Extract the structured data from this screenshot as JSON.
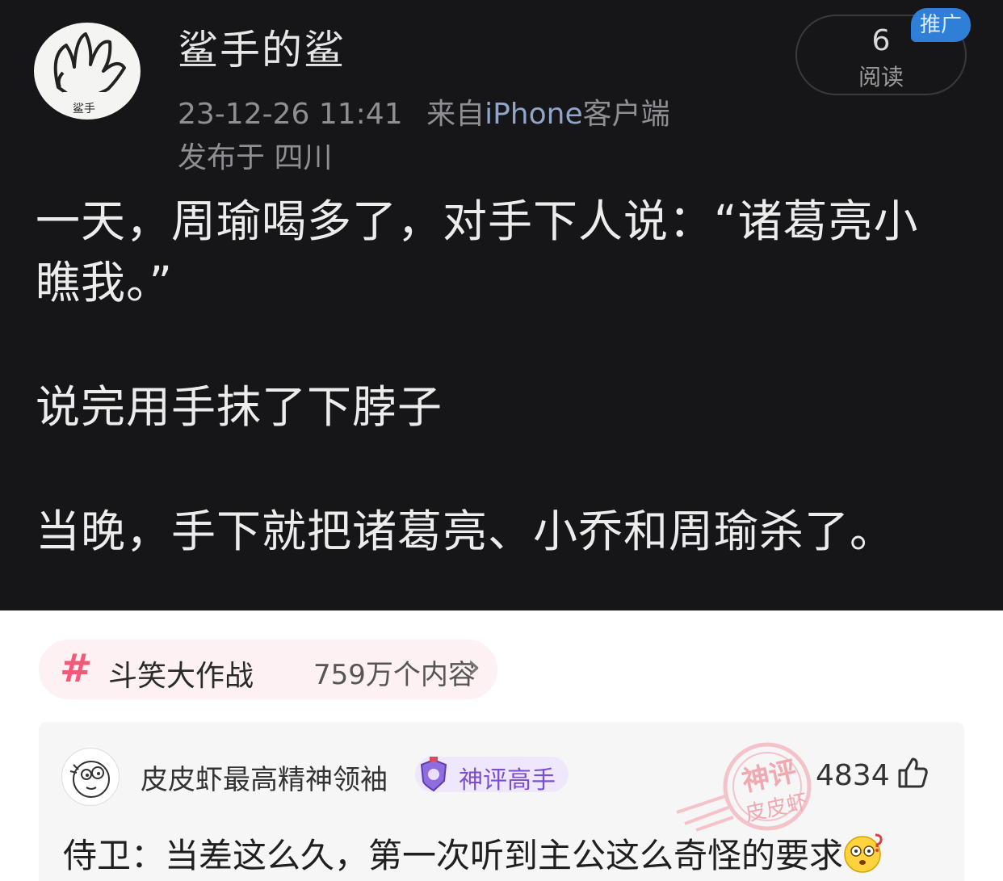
{
  "post": {
    "author": "鲨手的鲨",
    "avatar_text": "鲨手",
    "timestamp": "23-12-26 11:41",
    "source_prefix": "来自",
    "source_device": "iPhone",
    "source_suffix": "客户端",
    "location": "发布于 四川",
    "read_count": "6",
    "read_label": "阅读",
    "promo_badge": "推广",
    "lines": [
      "一天，周瑜喝多了，对手下人说：“诸葛亮小",
      "瞧我。”",
      "说完用手抹了下脖子",
      "当晚，手下就把诸葛亮、小乔和周瑜杀了。"
    ]
  },
  "topic": {
    "icon": "hash-icon",
    "name": "斗笑大作战",
    "count": "759万个内容",
    "chevron": "›"
  },
  "comment": {
    "username": "皮皮虾最高精神领袖",
    "badge": "神评高手",
    "stamp_text_top": "神评",
    "stamp_text_bottom": "皮皮虾",
    "likes": "4834",
    "text": "侍卫：当差这么久，第一次听到主公这么奇怪的要求"
  },
  "colors": {
    "post_bg": "#161518",
    "topic_accent": "#f15b7a",
    "badge_purple": "#7a4fd0",
    "promo_blue": "#2f7fd8"
  }
}
